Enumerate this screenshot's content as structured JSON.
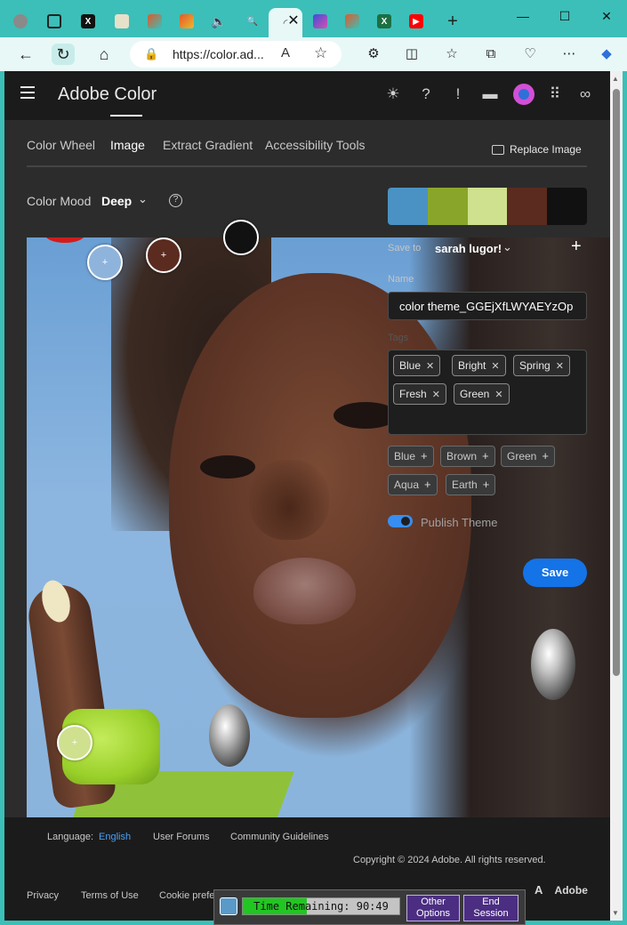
{
  "browser": {
    "tabs": [
      {
        "icon": "profile-icon"
      },
      {
        "icon": "window-icon"
      },
      {
        "icon": "x-twitter-icon"
      },
      {
        "icon": "notes-icon"
      },
      {
        "icon": "color-app-icon"
      },
      {
        "icon": "color-app-icon"
      },
      {
        "icon": "speaker-icon"
      },
      {
        "icon": "search-icon"
      },
      {
        "icon": "loading-icon",
        "active": true
      },
      {
        "icon": "close-icon"
      },
      {
        "icon": "app-icon"
      },
      {
        "icon": "color-app-icon"
      },
      {
        "icon": "excel-icon"
      },
      {
        "icon": "youtube-icon"
      }
    ],
    "new_tab_label": "+",
    "url": "https://color.ad...",
    "window_controls": [
      "minimize",
      "maximize",
      "close"
    ]
  },
  "app": {
    "title": "Adobe Color",
    "header_icons": [
      "theme-icon",
      "help-icon",
      "alert-icon",
      "chat-icon",
      "avatar",
      "apps-grid-icon",
      "creative-cloud-icon"
    ]
  },
  "tabs": [
    {
      "label": "Color Wheel",
      "selected": false
    },
    {
      "label": "Image",
      "selected": true
    },
    {
      "label": "Extract Gradient",
      "selected": false
    },
    {
      "label": "Accessibility Tools",
      "selected": false
    }
  ],
  "replace_image_label": "Replace Image",
  "color_mood": {
    "label": "Color Mood",
    "value": "Deep",
    "help": "?"
  },
  "swatches": [
    "#4a92c3",
    "#8aa62a",
    "#cfe08e",
    "#5b2b20",
    "#111111"
  ],
  "pickers": [
    {
      "color": "#8fb4dc",
      "mark": "+"
    },
    {
      "color": "#5b2b20",
      "mark": "+"
    },
    {
      "color": "#111111",
      "mark": ""
    },
    {
      "color": "#cfe08e",
      "mark": "+"
    }
  ],
  "save_panel": {
    "save_to_label": "Save to",
    "save_to_value": "sarah lugor!",
    "add_label": "+",
    "name_label": "Name",
    "name_value": "color theme_GGEjXfLWYAEYzOp",
    "tags_label": "Tags",
    "tags": [
      "Blue",
      "Bright",
      "Spring",
      "Fresh",
      "Green"
    ],
    "suggestions": [
      "Blue",
      "Brown",
      "Green",
      "Aqua",
      "Earth"
    ],
    "publish_label": "Publish Theme",
    "publish_on": true,
    "save_label": "Save"
  },
  "footer": {
    "language_label": "Language:",
    "language_value": "English",
    "user_forums": "User Forums",
    "community_guidelines": "Community Guidelines",
    "copyright": "Copyright © 2024 Adobe. All rights reserved.",
    "privacy": "Privacy",
    "terms": "Terms of Use",
    "cookie": "Cookie prefe",
    "adobe": "Adobe"
  },
  "session": {
    "timer_label": "Time Remaining: 90:49",
    "timer_fill": 0.41,
    "other_options": "Other Options",
    "end_session": "End Session"
  }
}
